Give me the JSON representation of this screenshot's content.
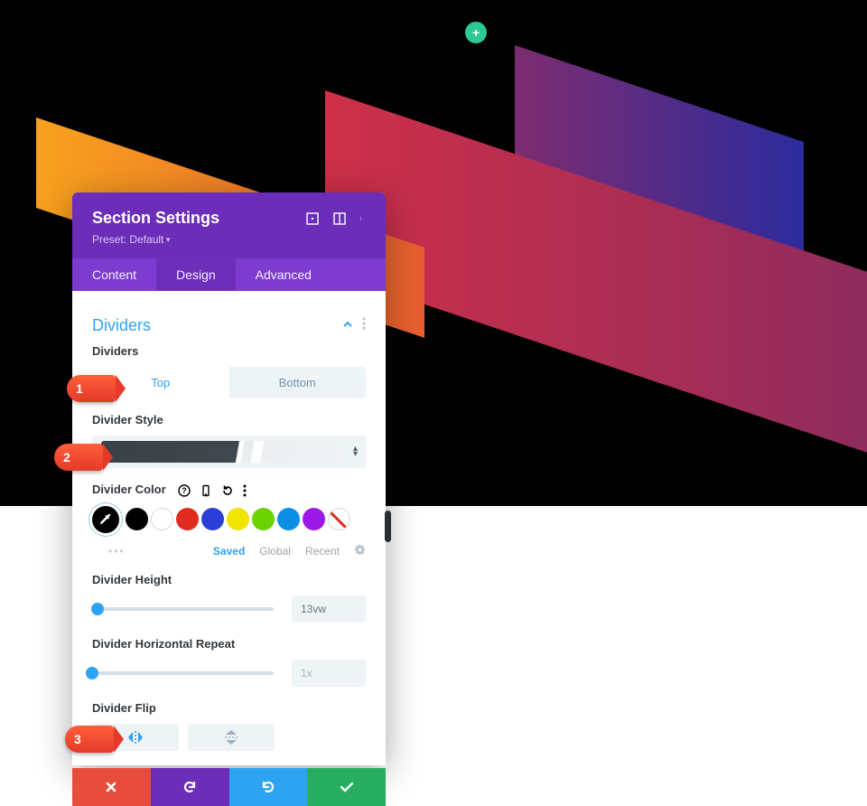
{
  "add_section_label": "+",
  "panel": {
    "title": "Section Settings",
    "preset": "Preset: Default",
    "tabs": {
      "content": "Content",
      "design": "Design",
      "advanced": "Advanced",
      "active": "design"
    },
    "accent": "#6c2eb9"
  },
  "section": {
    "title": "Dividers"
  },
  "labels": {
    "dividers": "Dividers",
    "style": "Divider Style",
    "color": "Divider Color",
    "height": "Divider Height",
    "repeat": "Divider Horizontal Repeat",
    "flip": "Divider Flip"
  },
  "tabpair": {
    "left": "Top",
    "right": "Bottom",
    "active": "left"
  },
  "color_palette": {
    "tabs": {
      "saved": "Saved",
      "global": "Global",
      "recent": "Recent",
      "active": "saved"
    },
    "colors": [
      "#000000",
      "#ffffff",
      "#e02b20",
      "#2b3fd6",
      "#efe500",
      "#6bd300",
      "#0b8ee6",
      "#9b19e6",
      "none"
    ]
  },
  "height": {
    "value": "13vw",
    "pct": 3
  },
  "repeat": {
    "value": "1x",
    "pct": 0
  },
  "callouts": {
    "1": "1",
    "2": "2",
    "3": "3"
  }
}
